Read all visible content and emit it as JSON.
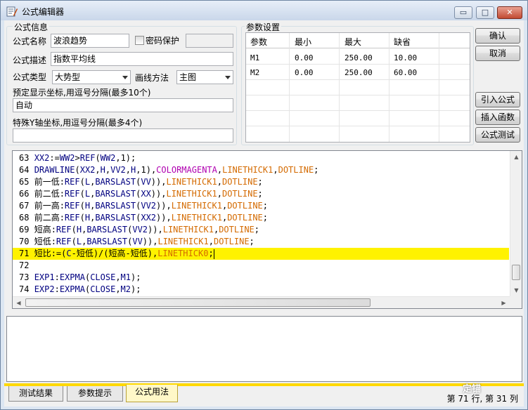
{
  "window": {
    "title": "公式编辑器",
    "controls": {
      "minimize": "▭",
      "maximize": "□",
      "close": "✕"
    }
  },
  "formula_info": {
    "group_title": "公式信息",
    "name_label": "公式名称",
    "name_value": "波浪趋势",
    "password_label": "密码保护",
    "password_checked": false,
    "desc_label": "公式描述",
    "desc_value": "指数平均线",
    "type_label": "公式类型",
    "type_value": "大势型",
    "draw_method_label": "画线方法",
    "draw_method_value": "主图",
    "preset_coords_label": "预定显示坐标,用逗号分隔(最多10个)",
    "preset_coords_value": "自动",
    "special_y_label": "特殊Y轴坐标,用逗号分隔(最多4个)",
    "special_y_value": ""
  },
  "params": {
    "group_title": "参数设置",
    "headers": [
      "参数",
      "最小",
      "最大",
      "缺省"
    ],
    "rows": [
      [
        "M1",
        "0.00",
        "250.00",
        "10.00"
      ],
      [
        "M2",
        "0.00",
        "250.00",
        "60.00"
      ]
    ]
  },
  "buttons": {
    "confirm": "确认",
    "cancel": "取消",
    "import_formula": "引入公式",
    "insert_function": "插入函数",
    "test_formula": "公式测试"
  },
  "editor": {
    "highlighted_line": 71,
    "lines": [
      {
        "no": "63",
        "text": "XX2:=WW2>REF(WW2,1);"
      },
      {
        "no": "64",
        "text": "DRAWLINE(XX2,H,VV2,H,1),COLORMAGENTA,LINETHICK1,DOTLINE;"
      },
      {
        "no": "65",
        "text": "前一低:REF(L,BARSLAST(VV)),LINETHICK1,DOTLINE;"
      },
      {
        "no": "66",
        "text": "前二低:REF(L,BARSLAST(XX)),LINETHICK1,DOTLINE;"
      },
      {
        "no": "67",
        "text": "前一高:REF(H,BARSLAST(VV2)),LINETHICK1,DOTLINE;"
      },
      {
        "no": "68",
        "text": "前二高:REF(H,BARSLAST(XX2)),LINETHICK1,DOTLINE;"
      },
      {
        "no": "69",
        "text": "短高:REF(H,BARSLAST(VV2)),LINETHICK1,DOTLINE;"
      },
      {
        "no": "70",
        "text": "短低:REF(L,BARSLAST(VV)),LINETHICK1,DOTLINE;"
      },
      {
        "no": "71",
        "text": "短比:=(C-短低)/(短高-短低),LINETHICK0;"
      },
      {
        "no": "72",
        "text": ""
      },
      {
        "no": "73",
        "text": "EXP1:EXPMA(CLOSE,M1);"
      },
      {
        "no": "74",
        "text": "EXP2:EXPMA(CLOSE,M2);"
      }
    ]
  },
  "tabs": [
    "测试结果",
    "参数提示",
    "公式用法"
  ],
  "active_tab": 2,
  "status": "第 71 行, 第 31 列",
  "watermark": "定锚",
  "colors": {
    "highlight": "#fff200",
    "keyword": "#d46a00",
    "color_const": "#b000b0",
    "identifier": "#000080",
    "tab_accent": "#ffd800"
  }
}
